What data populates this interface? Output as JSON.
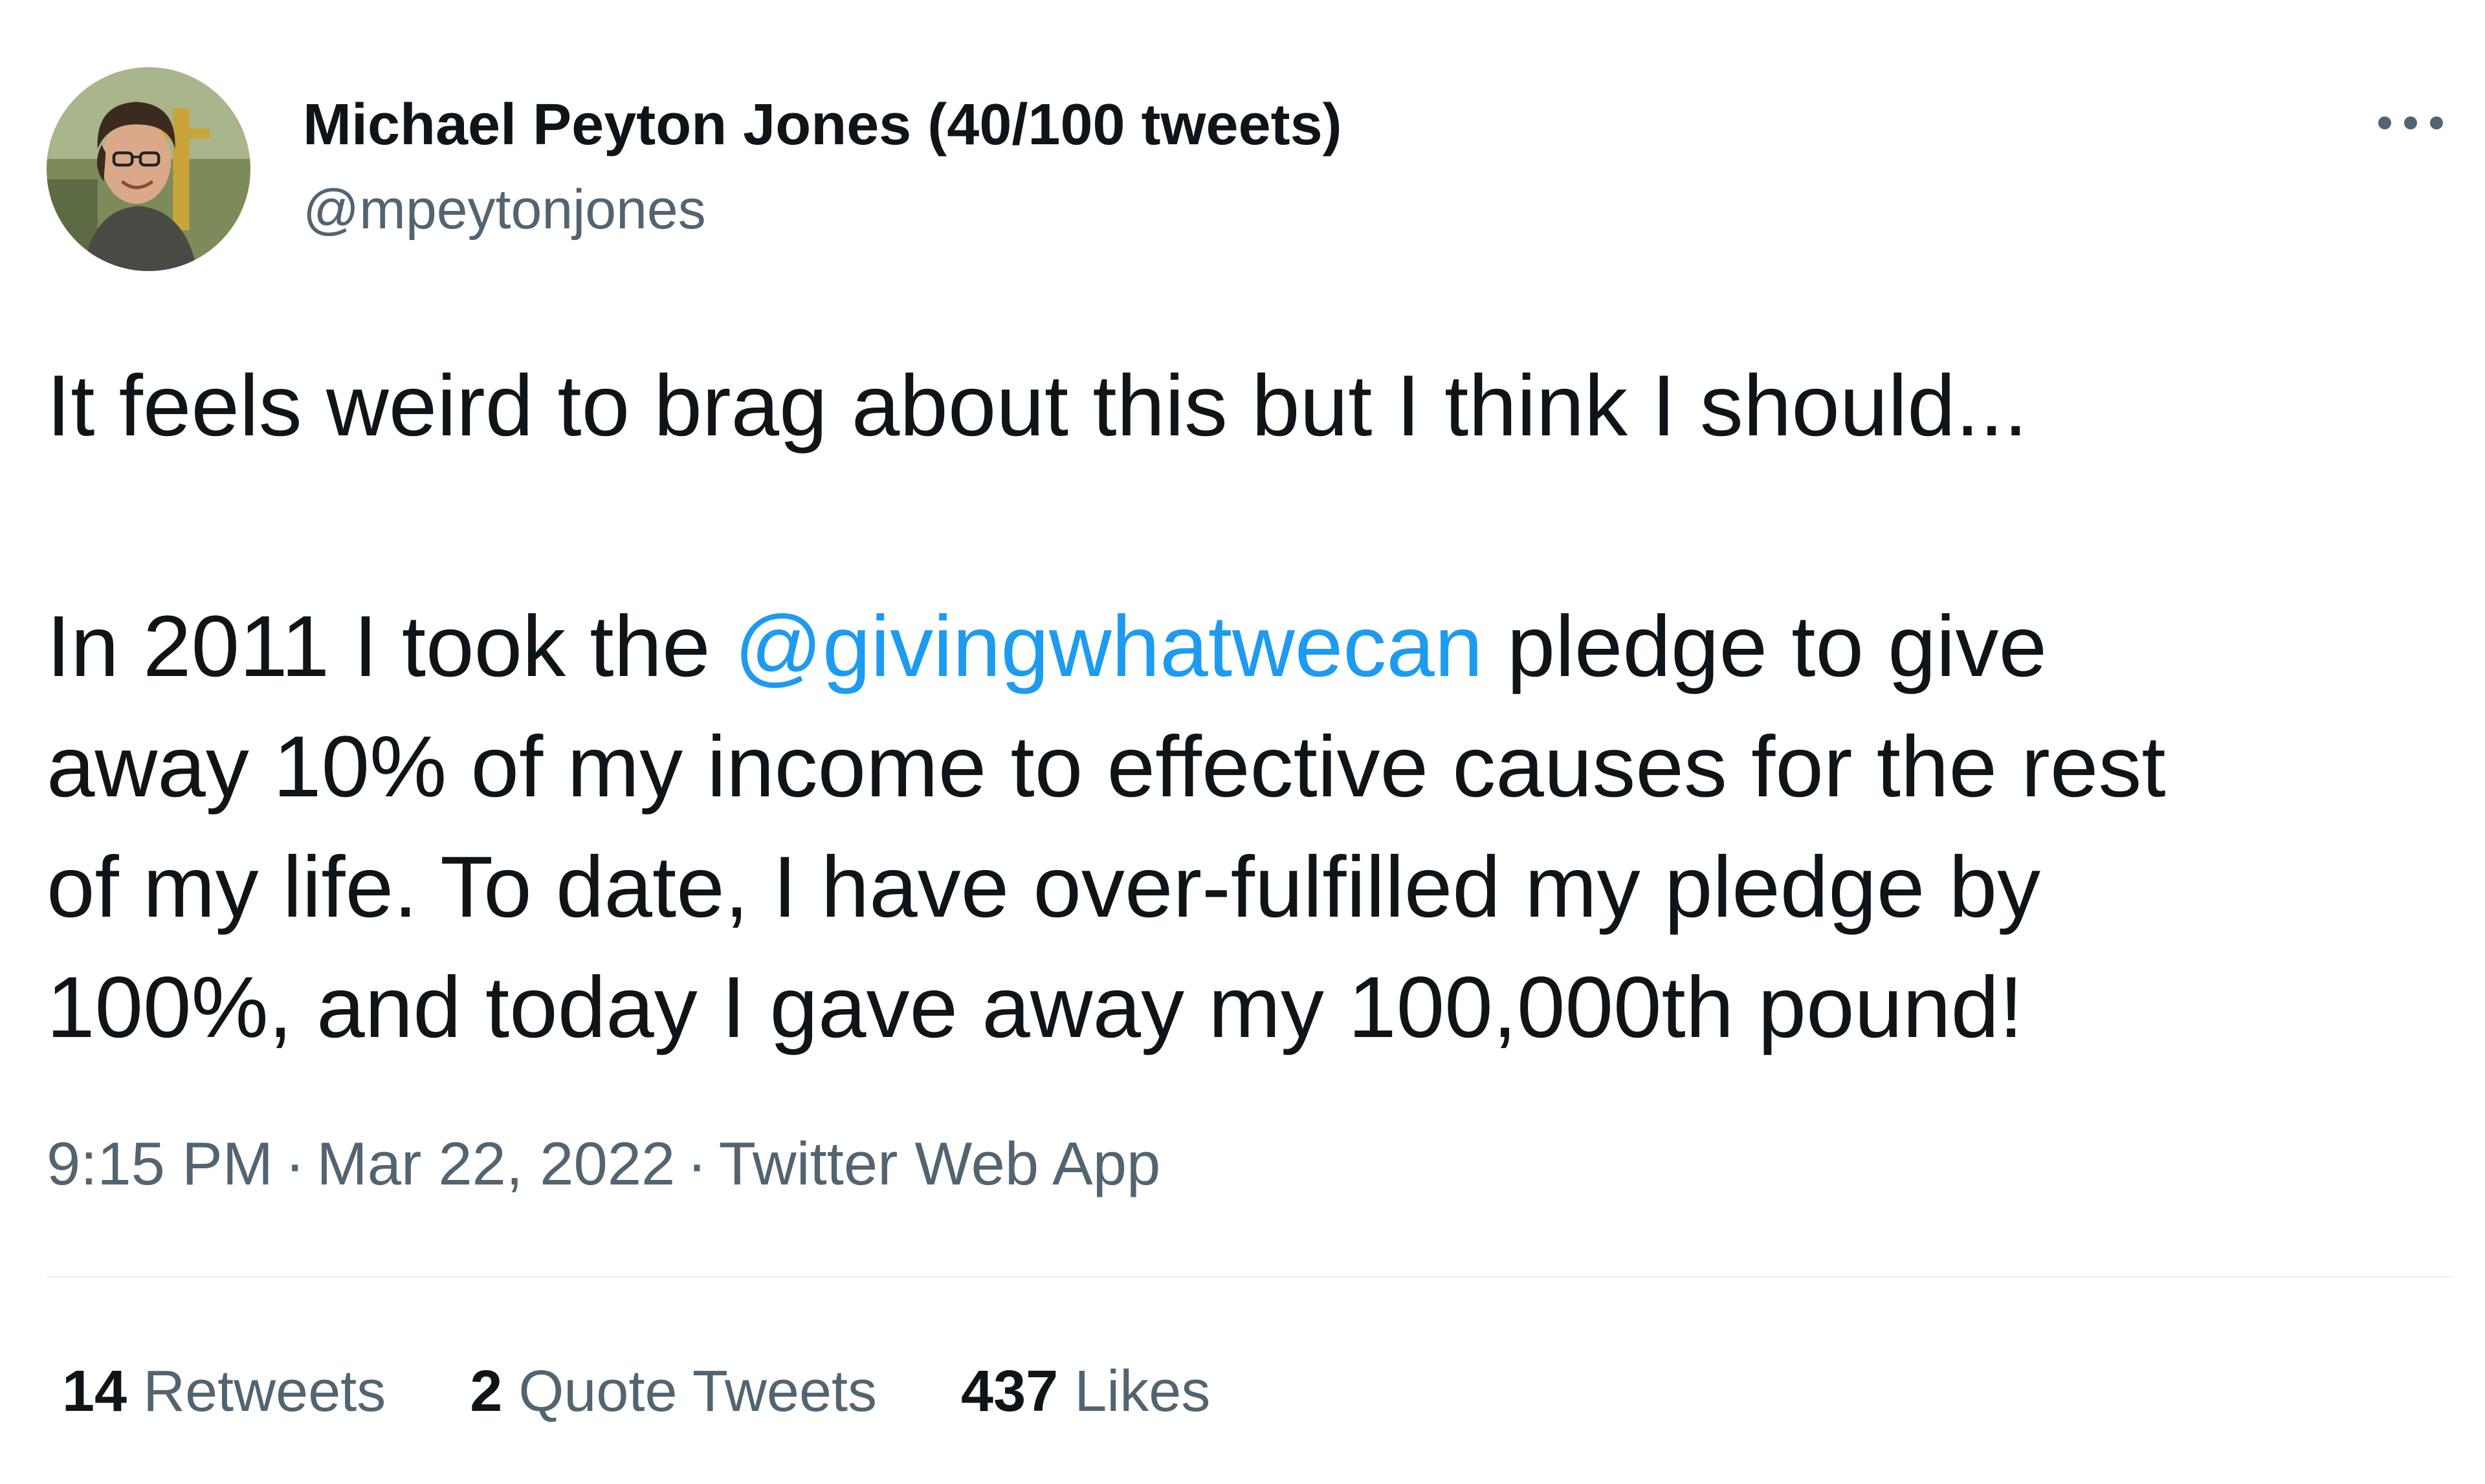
{
  "author": {
    "display_name": "Michael Peyton Jones (40/100 tweets)",
    "handle": "@mpeytonjones",
    "avatar_icon": "profile-photo"
  },
  "more_icon": "more-horizontal-icon",
  "tweet": {
    "line1": "It feels weird to brag about this but I think I should...",
    "line2_before": "In 2011 I took the ",
    "mention": "@givingwhatwecan",
    "line2_after": " pledge to give",
    "line3": "away 10% of my income to effective causes for the rest",
    "line4": "of my life. To date, I have over-fulfilled my pledge by",
    "line5": "100%, and today I gave away my 100,000th pound!"
  },
  "meta": {
    "time": "9:15 PM",
    "sep1": "·",
    "date": "Mar 22, 2022",
    "sep2": "·",
    "source": "Twitter Web App"
  },
  "stats": {
    "retweets_count": "14",
    "retweets_label": "Retweets",
    "quotes_count": "2",
    "quotes_label": "Quote Tweets",
    "likes_count": "437",
    "likes_label": "Likes"
  },
  "colors": {
    "text": "#0f1419",
    "secondary": "#536471",
    "link": "#1d9bf0",
    "divider": "#eff3f4"
  }
}
